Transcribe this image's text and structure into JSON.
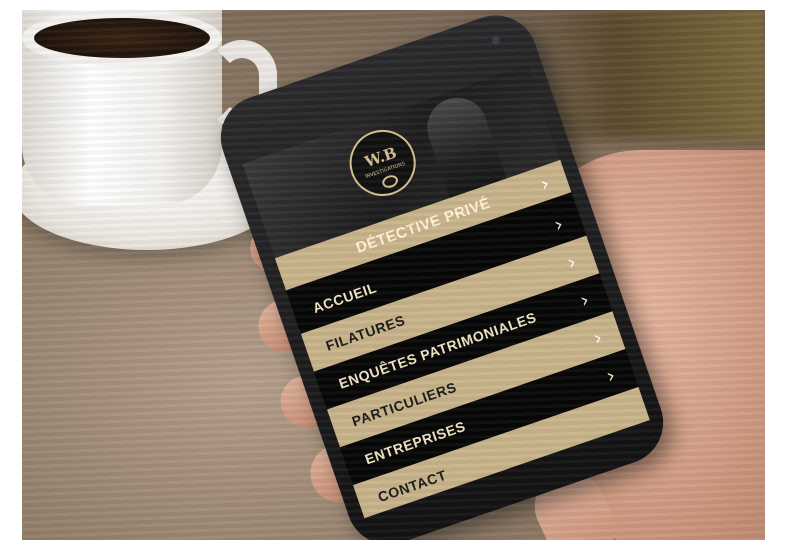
{
  "app": {
    "logo_text": "W.B",
    "logo_subtext": "INVESTIGATIONS",
    "hero_title": "DÉTECTIVE PRIVÉ"
  },
  "menu": {
    "items": [
      {
        "label": "ACCUEIL"
      },
      {
        "label": "FILATURES"
      },
      {
        "label": "ENQUÊTES PATRIMONIALES"
      },
      {
        "label": "PARTICULIERS"
      },
      {
        "label": "ENTREPRISES"
      },
      {
        "label": "CONTACT"
      }
    ],
    "chevron_icon": "chevron-right-icon"
  },
  "colors": {
    "gold": "#c9b48a",
    "black": "#070707"
  }
}
